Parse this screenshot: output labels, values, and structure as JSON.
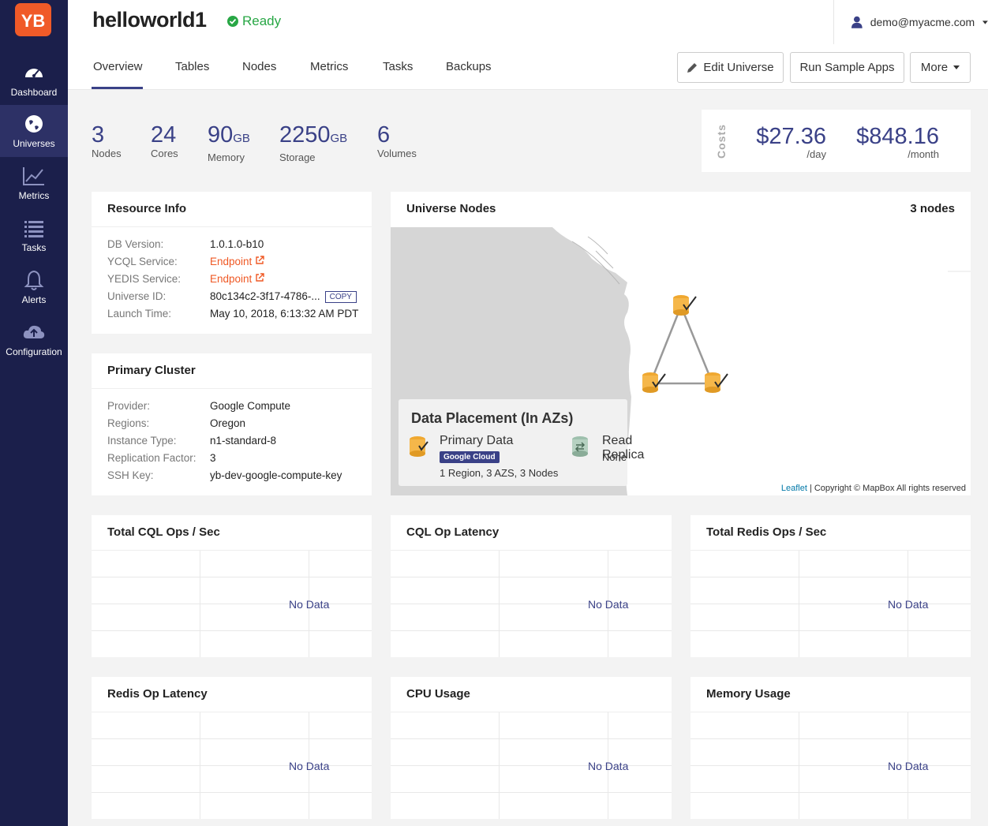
{
  "sidebar": {
    "logo": "YB",
    "items": [
      {
        "label": "Dashboard",
        "icon": "dashboard-icon"
      },
      {
        "label": "Universes",
        "icon": "globe-icon"
      },
      {
        "label": "Metrics",
        "icon": "chart-icon"
      },
      {
        "label": "Tasks",
        "icon": "list-icon"
      },
      {
        "label": "Alerts",
        "icon": "bell-icon"
      },
      {
        "label": "Configuration",
        "icon": "cloud-upload-icon"
      }
    ]
  },
  "header": {
    "title": "helloworld1",
    "status": "Ready",
    "user": "demo@myacme.com"
  },
  "tabs": [
    "Overview",
    "Tables",
    "Nodes",
    "Metrics",
    "Tasks",
    "Backups"
  ],
  "actions": {
    "edit": "Edit Universe",
    "run": "Run Sample Apps",
    "more": "More"
  },
  "stats": {
    "nodes": {
      "value": "3",
      "unit": "",
      "label": "Nodes"
    },
    "cores": {
      "value": "24",
      "unit": "",
      "label": "Cores"
    },
    "memory": {
      "value": "90",
      "unit": "GB",
      "label": "Memory"
    },
    "storage": {
      "value": "2250",
      "unit": "GB",
      "label": "Storage"
    },
    "volumes": {
      "value": "6",
      "unit": "",
      "label": "Volumes"
    }
  },
  "costs": {
    "label": "Costs",
    "day": "$27.36",
    "day_label": "/day",
    "month": "$848.16",
    "month_label": "/month"
  },
  "resource_info": {
    "title": "Resource Info",
    "rows": [
      {
        "k": "DB Version:",
        "v": "1.0.1.0-b10"
      },
      {
        "k": "YCQL Service:",
        "v": "Endpoint"
      },
      {
        "k": "YEDIS Service:",
        "v": "Endpoint"
      },
      {
        "k": "Universe ID:",
        "v": "80c134c2-3f17-4786-..."
      },
      {
        "k": "Launch Time:",
        "v": "May 10, 2018, 6:13:32 AM PDT"
      }
    ],
    "copy_label": "COPY"
  },
  "primary_cluster": {
    "title": "Primary Cluster",
    "rows": [
      {
        "k": "Provider:",
        "v": "Google Compute"
      },
      {
        "k": "Regions:",
        "v": "Oregon"
      },
      {
        "k": "Instance Type:",
        "v": "n1-standard-8"
      },
      {
        "k": "Replication Factor:",
        "v": "3"
      },
      {
        "k": "SSH Key:",
        "v": "yb-dev-google-compute-key"
      }
    ]
  },
  "universe_nodes": {
    "title": "Universe Nodes",
    "count": "3 nodes",
    "placement_title": "Data Placement (In AZs)",
    "primary_label": "Primary Data",
    "primary_badge": "Google Cloud",
    "primary_desc": "1 Region, 3 AZS, 3 Nodes",
    "replica_label": "Read Replica",
    "replica_desc": "None",
    "leaflet": "Leaflet",
    "copyright": "| Copyright © MapBox All rights reserved"
  },
  "charts": [
    {
      "title": "Total CQL Ops / Sec",
      "empty": "No Data"
    },
    {
      "title": "CQL Op Latency",
      "empty": "No Data"
    },
    {
      "title": "Total Redis Ops / Sec",
      "empty": "No Data"
    },
    {
      "title": "Redis Op Latency",
      "empty": "No Data"
    },
    {
      "title": "CPU Usage",
      "empty": "No Data"
    },
    {
      "title": "Memory Usage",
      "empty": "No Data"
    }
  ],
  "colors": {
    "sidebar": "#1b1f4b",
    "accent": "#3a4187",
    "ready": "#28a745",
    "link": "#ef5824"
  }
}
